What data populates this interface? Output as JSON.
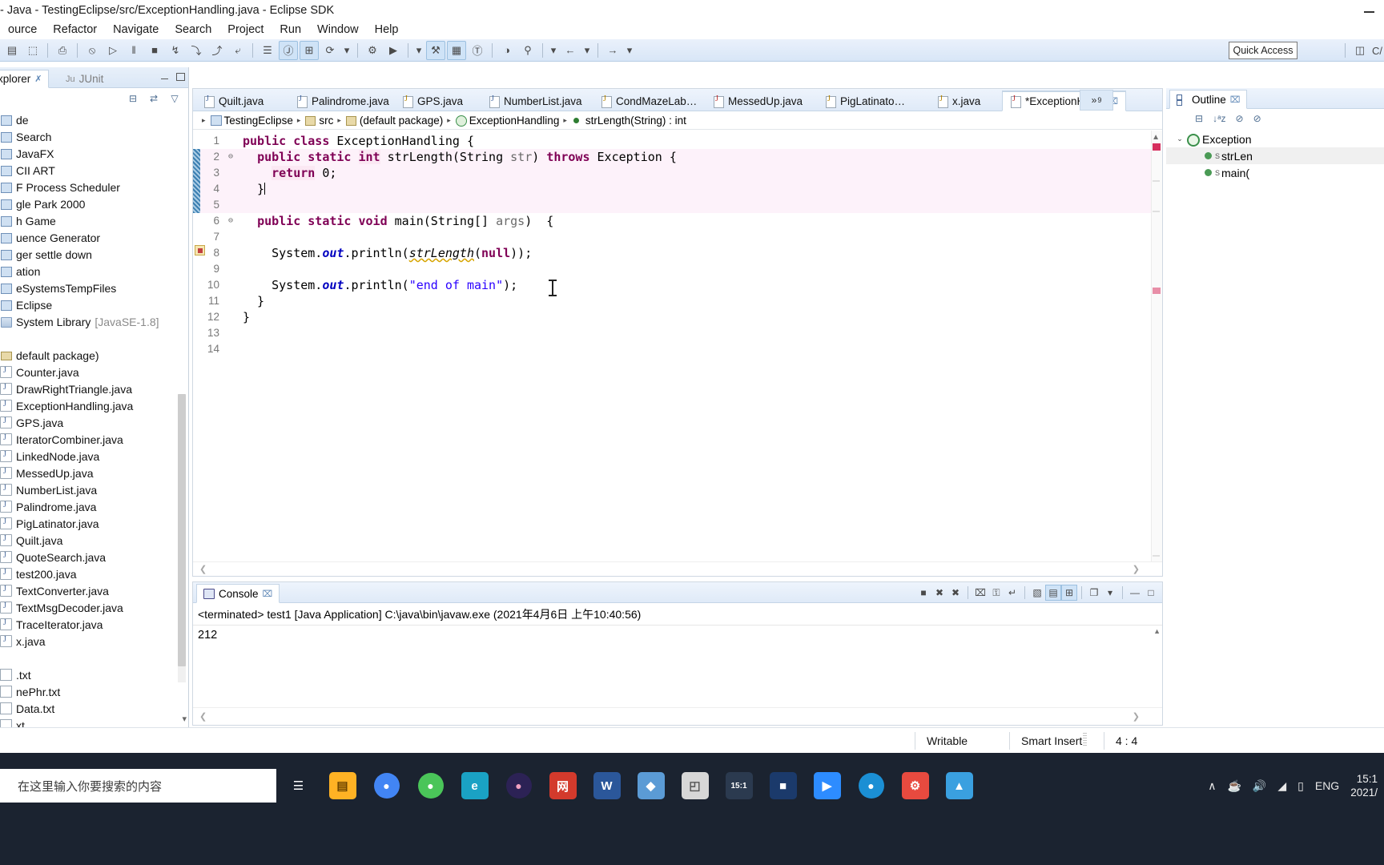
{
  "window": {
    "title": "- Java - TestingEclipse/src/ExceptionHandling.java - Eclipse SDK",
    "minimize_label": "–"
  },
  "menu": {
    "items": [
      "ource",
      "Refactor",
      "Navigate",
      "Search",
      "Project",
      "Run",
      "Window",
      "Help"
    ]
  },
  "toolbar": {
    "quick_access": "Quick Access",
    "perspective_label": "C/",
    "items": [
      {
        "name": "new-wizard-icon",
        "glyph": "▤"
      },
      {
        "name": "save-icon",
        "glyph": "⬚"
      },
      {
        "name": "print-icon",
        "glyph": "⎙"
      },
      {
        "name": "debug-skip-icon",
        "glyph": "⦸"
      },
      {
        "name": "resume-icon",
        "glyph": "▷"
      },
      {
        "name": "suspend-icon",
        "glyph": "‖"
      },
      {
        "name": "terminate-icon",
        "glyph": "■"
      },
      {
        "name": "disconnect-icon",
        "glyph": "↯"
      },
      {
        "name": "step-into-icon",
        "glyph": "⤵"
      },
      {
        "name": "step-over-icon",
        "glyph": "⤴"
      },
      {
        "name": "step-return-icon",
        "glyph": "⤶"
      },
      {
        "name": "next-annotation-icon",
        "glyph": "☰"
      },
      {
        "name": "java-editor-icon",
        "glyph": "Ⓙ"
      },
      {
        "name": "new-java-class-icon",
        "glyph": "⊞"
      },
      {
        "name": "run-external-tools-icon",
        "glyph": "⟳"
      },
      {
        "name": "run-dropdown-arrow",
        "glyph": "▾"
      },
      {
        "name": "debug-icon",
        "glyph": "⚙"
      },
      {
        "name": "run-icon",
        "glyph": "▶"
      },
      {
        "name": "run-dropdown2-arrow",
        "glyph": "▾"
      },
      {
        "name": "profile-icon",
        "glyph": "⚒"
      },
      {
        "name": "new-java-project-icon",
        "glyph": "▦"
      },
      {
        "name": "open-type-icon",
        "glyph": "Ⓣ"
      },
      {
        "name": "coverage-icon",
        "glyph": "◑"
      },
      {
        "name": "search-icon",
        "glyph": "⚲"
      },
      {
        "name": "search-dropdown-arrow",
        "glyph": "▾"
      },
      {
        "name": "back-nav-icon",
        "glyph": "←"
      },
      {
        "name": "back-dropdown-arrow",
        "glyph": "▾"
      },
      {
        "name": "forward-nav-icon",
        "glyph": "→"
      },
      {
        "name": "forward-dropdown-arrow",
        "glyph": "▾"
      }
    ]
  },
  "package_explorer": {
    "tab_label": "xplorer",
    "tab_label_2": "JUnit",
    "tab_icon_2": "Ju",
    "collapse_all_icon": "⊟",
    "link_editor_icon": "⇄",
    "view_menu_icon": "▽",
    "items": [
      {
        "label": "de",
        "icon": "project",
        "dim": ""
      },
      {
        "label": "Search",
        "icon": "project",
        "dim": ""
      },
      {
        "label": "JavaFX",
        "icon": "project",
        "dim": ""
      },
      {
        "label": "CII ART",
        "icon": "project",
        "dim": ""
      },
      {
        "label": "F Process Scheduler",
        "icon": "project",
        "dim": ""
      },
      {
        "label": "gle Park 2000",
        "icon": "project",
        "dim": ""
      },
      {
        "label": "h Game",
        "icon": "project",
        "dim": ""
      },
      {
        "label": "uence Generator",
        "icon": "project",
        "dim": ""
      },
      {
        "label": "ger settle down",
        "icon": "project",
        "dim": ""
      },
      {
        "label": "ation",
        "icon": "project",
        "dim": ""
      },
      {
        "label": "eSystemsTempFiles",
        "icon": "project",
        "dim": ""
      },
      {
        "label": "Eclipse",
        "icon": "project",
        "dim": ""
      },
      {
        "label": "System Library",
        "icon": "lib",
        "dim": "[JavaSE-1.8]"
      },
      {
        "label": "",
        "icon": "none",
        "dim": ""
      },
      {
        "label": "default package)",
        "icon": "pkg",
        "dim": ""
      },
      {
        "label": "Counter.java",
        "icon": "java",
        "dim": ""
      },
      {
        "label": "DrawRightTriangle.java",
        "icon": "java",
        "dim": ""
      },
      {
        "label": "ExceptionHandling.java",
        "icon": "java",
        "dim": ""
      },
      {
        "label": "GPS.java",
        "icon": "java",
        "dim": ""
      },
      {
        "label": "IteratorCombiner.java",
        "icon": "java",
        "dim": ""
      },
      {
        "label": "LinkedNode.java",
        "icon": "java",
        "dim": ""
      },
      {
        "label": "MessedUp.java",
        "icon": "java",
        "dim": ""
      },
      {
        "label": "NumberList.java",
        "icon": "java",
        "dim": ""
      },
      {
        "label": "Palindrome.java",
        "icon": "java",
        "dim": ""
      },
      {
        "label": "PigLatinator.java",
        "icon": "java",
        "dim": ""
      },
      {
        "label": "Quilt.java",
        "icon": "java",
        "dim": ""
      },
      {
        "label": "QuoteSearch.java",
        "icon": "java",
        "dim": ""
      },
      {
        "label": "test200.java",
        "icon": "java",
        "dim": ""
      },
      {
        "label": "TextConverter.java",
        "icon": "java",
        "dim": ""
      },
      {
        "label": "TextMsgDecoder.java",
        "icon": "java",
        "dim": ""
      },
      {
        "label": "TraceIterator.java",
        "icon": "java",
        "dim": ""
      },
      {
        "label": "x.java",
        "icon": "java",
        "dim": ""
      },
      {
        "label": "",
        "icon": "none",
        "dim": ""
      },
      {
        "label": ".txt",
        "icon": "txt",
        "dim": ""
      },
      {
        "label": "nePhr.txt",
        "icon": "txt",
        "dim": ""
      },
      {
        "label": "Data.txt",
        "icon": "txt",
        "dim": ""
      },
      {
        "label": "xt",
        "icon": "txt",
        "dim": ""
      }
    ]
  },
  "editor": {
    "tabs": [
      {
        "label": "Quilt.java",
        "icon": "plain",
        "selected": false
      },
      {
        "label": "Palindrome.java",
        "icon": "plain",
        "selected": false
      },
      {
        "label": "GPS.java",
        "icon": "warn",
        "selected": false
      },
      {
        "label": "NumberList.java",
        "icon": "plain",
        "selected": false
      },
      {
        "label": "CondMazeLab…",
        "icon": "warn",
        "selected": false
      },
      {
        "label": "MessedUp.java",
        "icon": "err",
        "selected": false
      },
      {
        "label": "PigLatinato…",
        "icon": "warn",
        "selected": false
      },
      {
        "label": "x.java",
        "icon": "warn",
        "selected": false
      },
      {
        "label": "*ExceptionHa…",
        "icon": "err",
        "selected": true
      }
    ],
    "tab_close_glyph": "⌧",
    "more_tabs_label": "»",
    "more_tabs_count": "9",
    "breadcrumb": [
      {
        "label": "TestingEclipse",
        "icon": "p"
      },
      {
        "label": "src",
        "icon": "s"
      },
      {
        "label": "(default package)",
        "icon": "s"
      },
      {
        "label": "ExceptionHandling",
        "icon": "c"
      },
      {
        "label": "strLength(String) : int",
        "icon": "m"
      }
    ],
    "lines": [
      {
        "n": "1",
        "fold": "",
        "html": "<span class=\"kw\">public</span> <span class=\"kw\">class</span> ExceptionHandling {"
      },
      {
        "n": "2",
        "fold": "⊖",
        "html": "  <span class=\"kw\">public</span> <span class=\"kw\">static</span> <span class=\"kw2\">int</span> strLength(String <span class=\"param\">str</span>) <span class=\"kw\">throws</span> Exception {"
      },
      {
        "n": "3",
        "fold": "",
        "html": "    <span class=\"kw2\">return</span> 0;"
      },
      {
        "n": "4",
        "fold": "",
        "html": "  }<span class=\"caretbar\"></span>"
      },
      {
        "n": "5",
        "fold": "",
        "html": ""
      },
      {
        "n": "6",
        "fold": "⊖",
        "html": "  <span class=\"kw\">public</span> <span class=\"kw\">static</span> <span class=\"kw\">void</span> main(String[] <span class=\"param\">args</span>)  {"
      },
      {
        "n": "7",
        "fold": "",
        "html": ""
      },
      {
        "n": "8",
        "fold": "",
        "html": "    System.<span class=\"fld\">out</span>.println(<span class=\"mcall\">strLength</span>(<span class=\"kw\">null</span>));"
      },
      {
        "n": "9",
        "fold": "",
        "html": ""
      },
      {
        "n": "10",
        "fold": "",
        "html": "    System.<span class=\"fld\">out</span>.println(<span class=\"str\">\"end of main\"</span>);"
      },
      {
        "n": "11",
        "fold": "",
        "html": "  }"
      },
      {
        "n": "12",
        "fold": "",
        "html": "}"
      },
      {
        "n": "13",
        "fold": "",
        "html": ""
      },
      {
        "n": "14",
        "fold": "",
        "html": ""
      }
    ]
  },
  "console": {
    "tab_label": "Console",
    "tab_close_glyph": "⌧",
    "terminated_line": "<terminated> test1 [Java Application] C:\\java\\bin\\javaw.exe (2021年4月6日 上午10:40:56)",
    "output": "212",
    "tools": [
      {
        "name": "terminate-icon",
        "glyph": "■"
      },
      {
        "name": "remove-launch-icon",
        "glyph": "✖"
      },
      {
        "name": "remove-all-terminated-icon",
        "glyph": "✖"
      },
      {
        "name": "clear-console-icon",
        "glyph": "⌧"
      },
      {
        "name": "scroll-lock-icon",
        "glyph": "⚿"
      },
      {
        "name": "word-wrap-icon",
        "glyph": "↵"
      },
      {
        "name": "pin-console-icon",
        "glyph": "▧"
      },
      {
        "name": "display-selected-console-icon",
        "glyph": "▤"
      },
      {
        "name": "open-console-icon",
        "glyph": "⊞"
      },
      {
        "name": "new-console-view-icon",
        "glyph": "❐"
      },
      {
        "name": "console-menu-arrow",
        "glyph": "▾"
      },
      {
        "name": "minimize-console-icon",
        "glyph": "—"
      },
      {
        "name": "maximize-console-icon",
        "glyph": "□"
      }
    ]
  },
  "outline": {
    "tab_label": "Outline",
    "tab_close_glyph": "⌧",
    "tools": [
      {
        "name": "collapse-all-icon",
        "glyph": "⊟"
      },
      {
        "name": "sort-icon",
        "glyph": "↓ᵃz"
      },
      {
        "name": "hide-fields-icon",
        "glyph": "⊘"
      },
      {
        "name": "hide-static-icon",
        "glyph": "⊘"
      }
    ],
    "items": [
      {
        "label": "Exception",
        "kind": "class",
        "indent": 0,
        "twisty": "⌄",
        "modifier": ""
      },
      {
        "label": "strLen",
        "kind": "method",
        "indent": 1,
        "twisty": "",
        "modifier": "S",
        "selected": true
      },
      {
        "label": "main(",
        "kind": "method",
        "indent": 1,
        "twisty": "",
        "modifier": "S",
        "selected": false
      }
    ]
  },
  "status_bar": {
    "writable": "Writable",
    "insert_mode": "Smart Insert",
    "cursor_position": "4 : 4"
  },
  "taskbar": {
    "search_placeholder": "在这里输入你要搜索的内容",
    "apps": [
      {
        "name": "task-view-icon",
        "glyph": "☰",
        "color": "#1b2330",
        "text": "#ffffff"
      },
      {
        "name": "file-explorer-icon",
        "glyph": "▤",
        "color": "#ffb224",
        "text": "#6b4400"
      },
      {
        "name": "chrome-icon",
        "glyph": "●",
        "color": "#4285f4",
        "text": "#ffffff"
      },
      {
        "name": "wechat-icon",
        "glyph": "●",
        "color": "#4ac559",
        "text": "#ffffff"
      },
      {
        "name": "edge-legacy-icon",
        "glyph": "e",
        "color": "#1aa2c4",
        "text": "#ffffff"
      },
      {
        "name": "eclipse-icon",
        "glyph": "●",
        "color": "#2c2255",
        "text": "#f0a0c0"
      },
      {
        "name": "netease-icon",
        "glyph": "网",
        "color": "#d33a2c",
        "text": "#ffffff"
      },
      {
        "name": "word-icon",
        "glyph": "W",
        "color": "#2b579a",
        "text": "#ffffff"
      },
      {
        "name": "teams-icon",
        "glyph": "◆",
        "color": "#5b9bd5",
        "text": "#ffffff"
      },
      {
        "name": "photos-icon",
        "glyph": "◰",
        "color": "#d7d7d7",
        "text": "#555555"
      },
      {
        "name": "clock-icon",
        "glyph": "15:1",
        "color": "#2b3a4f",
        "text": "#ffffff"
      },
      {
        "name": "store-icon",
        "glyph": "■",
        "color": "#1b3a6b",
        "text": "#ffffff"
      },
      {
        "name": "zoom-icon",
        "glyph": "▶",
        "color": "#2d8cff",
        "text": "#ffffff"
      },
      {
        "name": "edge-icon",
        "glyph": "●",
        "color": "#1b8fd4",
        "text": "#ffffff"
      },
      {
        "name": "settings-icon",
        "glyph": "⚙",
        "color": "#e84a3f",
        "text": "#ffffff"
      },
      {
        "name": "maps-icon",
        "glyph": "▲",
        "color": "#3aa0e0",
        "text": "#ffffff"
      }
    ],
    "tray": {
      "expand_glyph": "∧",
      "java-icon": "☕",
      "volume_glyph": "ὐA",
      "network_glyph": "◢",
      "battery_glyph": "▭",
      "language": "ENG",
      "time": "15:1",
      "date": "2021/"
    }
  },
  "colors": {
    "accent": "#3c7fb1",
    "keyword": "#7f0055",
    "string": "#2a00ff",
    "field": "#0000c0",
    "error_marker": "#d62f5e",
    "taskbar_bg": "#1b2330"
  }
}
